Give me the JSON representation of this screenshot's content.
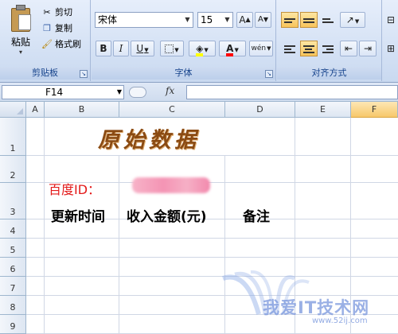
{
  "clipboard": {
    "group_label": "剪贴板",
    "paste_label": "粘贴",
    "cut_label": "剪切",
    "copy_label": "复制",
    "format_painter_label": "格式刷"
  },
  "font": {
    "group_label": "字体",
    "font_name": "宋体",
    "font_size": "15",
    "grow_glyph": "A",
    "shrink_glyph": "A",
    "bold_glyph": "B",
    "italic_glyph": "I",
    "underline_glyph": "U",
    "font_color_glyph": "A",
    "phonetic_glyph": "wén"
  },
  "alignment": {
    "group_label": "对齐方式"
  },
  "formula_bar": {
    "name_box": "F14",
    "fx_label": "fx",
    "formula": ""
  },
  "columns": [
    "A",
    "B",
    "C",
    "D",
    "E",
    "F"
  ],
  "selected_column": "F",
  "rows": [
    "1",
    "2",
    "3",
    "4",
    "5",
    "6",
    "7",
    "8",
    "9"
  ],
  "sheet": {
    "title": "原始数据",
    "id_label": "百度ID：",
    "headers": [
      "更新时间",
      "收入金额(元)",
      "备注"
    ]
  },
  "watermark": {
    "text": "我爱IT技术网",
    "url": "www.52ij.com"
  },
  "colors": {
    "title": "#8a4a12",
    "id_label": "#e31a1a",
    "ribbon": "#c9d9f0",
    "selected_header": "#f7c86b"
  }
}
